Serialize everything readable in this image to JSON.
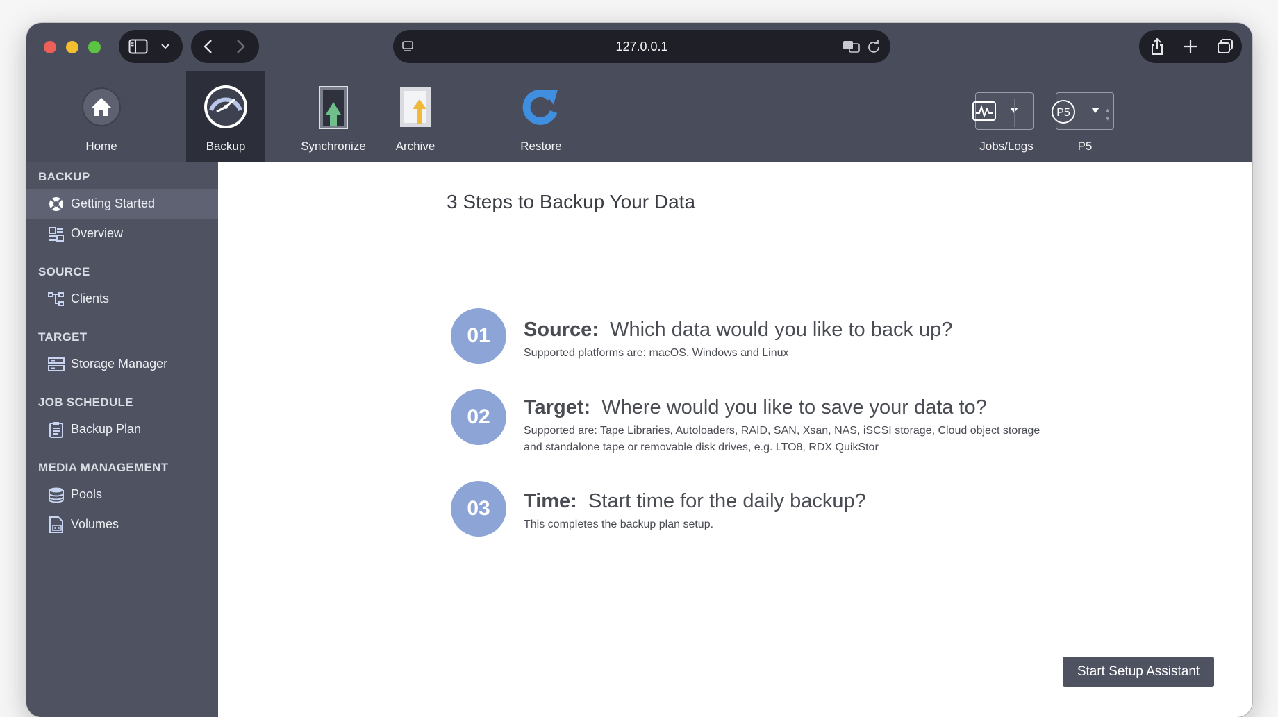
{
  "browser": {
    "url": "127.0.0.1"
  },
  "toolbar": {
    "items": [
      {
        "label": "Home",
        "icon": "home-icon"
      },
      {
        "label": "Backup",
        "icon": "backup-clock-icon",
        "active": true
      },
      {
        "label": "Synchronize",
        "icon": "synchronize-icon"
      },
      {
        "label": "Archive",
        "icon": "archive-icon"
      },
      {
        "label": "Restore",
        "icon": "restore-icon"
      }
    ],
    "right": [
      {
        "label": "Jobs/Logs",
        "icon": "activity-monitor-icon"
      },
      {
        "label": "P5",
        "icon": "p5-logo-icon"
      }
    ]
  },
  "sidebar": {
    "sections": [
      {
        "title": "BACKUP",
        "items": [
          {
            "label": "Getting Started",
            "icon": "lifebuoy-icon",
            "active": true
          },
          {
            "label": "Overview",
            "icon": "overview-grid-icon"
          }
        ]
      },
      {
        "title": "SOURCE",
        "items": [
          {
            "label": "Clients",
            "icon": "clients-tree-icon"
          }
        ]
      },
      {
        "title": "TARGET",
        "items": [
          {
            "label": "Storage Manager",
            "icon": "storage-icon"
          }
        ]
      },
      {
        "title": "JOB SCHEDULE",
        "items": [
          {
            "label": "Backup Plan",
            "icon": "clipboard-icon"
          }
        ]
      },
      {
        "title": "MEDIA MANAGEMENT",
        "items": [
          {
            "label": "Pools",
            "icon": "database-icon"
          },
          {
            "label": "Volumes",
            "icon": "volume-icon"
          }
        ]
      }
    ]
  },
  "main": {
    "title": "3 Steps to Backup Your Data",
    "steps": [
      {
        "number": "01",
        "heading": "Source:",
        "question": "Which data would you like to back up?",
        "description": "Supported platforms are: macOS, Windows and Linux"
      },
      {
        "number": "02",
        "heading": "Target:",
        "question": "Where would you like to save your data to?",
        "description": "Supported are: Tape Libraries, Autoloaders, RAID, SAN, Xsan, NAS, iSCSI storage, Cloud object storage and standalone tape or removable disk drives, e.g. LTO8, RDX QuikStor"
      },
      {
        "number": "03",
        "heading": "Time:",
        "question": "Start time for the daily backup?",
        "description": "This completes the backup plan setup."
      }
    ],
    "setup_button": "Start Setup Assistant"
  },
  "colors": {
    "accent_circle": "#8ca4d6",
    "sidebar_bg": "#4e5261",
    "toolbar_bg": "#494d5b",
    "button_bg": "#4f5361"
  }
}
